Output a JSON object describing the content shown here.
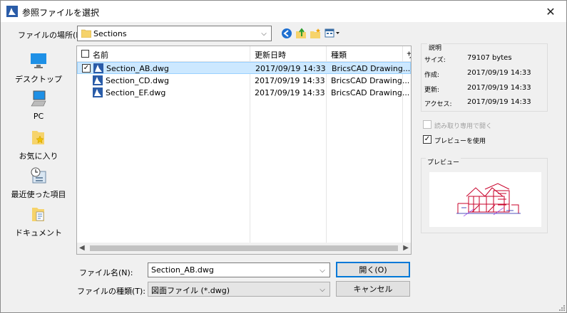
{
  "window": {
    "title": "参照ファイルを選択",
    "close_glyph": "✕"
  },
  "location": {
    "label": "ファイルの場所(I):",
    "value": "Sections"
  },
  "toolbar": {
    "back_icon": "back-icon",
    "up_icon": "up-folder-icon",
    "new_folder_icon": "new-folder-icon",
    "views_icon": "views-menu-icon"
  },
  "places": [
    {
      "label": "デスクトップ",
      "icon": "desktop-icon"
    },
    {
      "label": "PC",
      "icon": "pc-icon"
    },
    {
      "label": "お気に入り",
      "icon": "favorites-icon"
    },
    {
      "label": "最近使った項目",
      "icon": "recent-icon"
    },
    {
      "label": "ドキュメント",
      "icon": "documents-icon"
    }
  ],
  "filelist": {
    "columns": [
      "名前",
      "更新日時",
      "種類",
      "サ"
    ],
    "rows": [
      {
        "name": "Section_AB.dwg",
        "date": "2017/09/19 14:33",
        "type": "BricsCAD Drawing...",
        "selected": true,
        "checked": true
      },
      {
        "name": "Section_CD.dwg",
        "date": "2017/09/19 14:33",
        "type": "BricsCAD Drawing...",
        "selected": false,
        "checked": false
      },
      {
        "name": "Section_EF.dwg",
        "date": "2017/09/19 14:33",
        "type": "BricsCAD Drawing...",
        "selected": false,
        "checked": false
      }
    ]
  },
  "info": {
    "caption": "説明",
    "rows": [
      {
        "label": "サイズ:",
        "value": "79107 bytes"
      },
      {
        "label": "作成:",
        "value": "2017/09/19 14:33"
      },
      {
        "label": "更新:",
        "value": "2017/09/19 14:33"
      },
      {
        "label": "アクセス:",
        "value": "2017/09/19 14:33"
      }
    ]
  },
  "options": {
    "readonly_label": "読み取り専用で開く",
    "readonly_checked": false,
    "readonly_disabled": true,
    "preview_label": "プレビューを使用",
    "preview_checked": true
  },
  "preview": {
    "caption": "プレビュー"
  },
  "filename": {
    "label": "ファイル名(N):",
    "value": "Section_AB.dwg"
  },
  "filetype": {
    "label": "ファイルの種類(T):",
    "value": "図面ファイル (*.dwg)"
  },
  "buttons": {
    "open": "開く(O)",
    "cancel": "キャンセル"
  },
  "colors": {
    "accent": "#0078d7",
    "selection": "#cce8ff",
    "folder": "#f6d36b",
    "bricscad_blue": "#2a5ca8"
  }
}
